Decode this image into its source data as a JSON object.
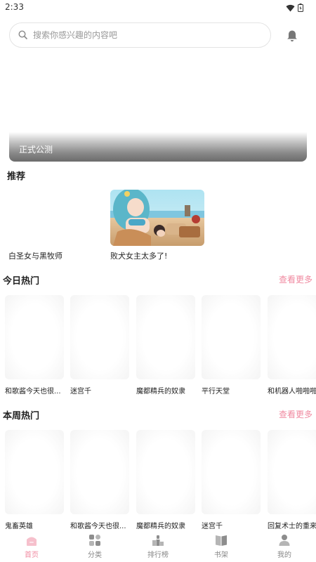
{
  "status": {
    "time": "2:33"
  },
  "search": {
    "placeholder": "搜索你感兴趣的内容吧"
  },
  "banner": {
    "title": "正式公测"
  },
  "recommend": {
    "title": "推荐",
    "items": [
      {
        "name": "白圣女与黑牧师"
      },
      {
        "name": "败犬女主太多了!"
      }
    ]
  },
  "today_hot": {
    "title": "今日热门",
    "more": "查看更多",
    "items": [
      {
        "name": "和歌酱今天也很..."
      },
      {
        "name": "迷宫千"
      },
      {
        "name": "魔都精兵的奴隶"
      },
      {
        "name": "平行天堂"
      },
      {
        "name": "和机器人啪啪啪"
      }
    ]
  },
  "week_hot": {
    "title": "本周热门",
    "more": "查看更多",
    "items": [
      {
        "name": "鬼畜英雄"
      },
      {
        "name": "和歌酱今天也很..."
      },
      {
        "name": "魔都精兵的奴隶"
      },
      {
        "name": "迷宫千"
      },
      {
        "name": "回复术士的重来人生"
      }
    ]
  },
  "tabs": [
    {
      "label": "首页",
      "icon": "home-icon",
      "active": true
    },
    {
      "label": "分类",
      "icon": "category-icon",
      "active": false
    },
    {
      "label": "排行榜",
      "icon": "ranking-icon",
      "active": false
    },
    {
      "label": "书架",
      "icon": "bookshelf-icon",
      "active": false
    },
    {
      "label": "我的",
      "icon": "profile-icon",
      "active": false
    }
  ],
  "colors": {
    "accent": "#f08aa0",
    "tab_inactive": "#888888"
  }
}
